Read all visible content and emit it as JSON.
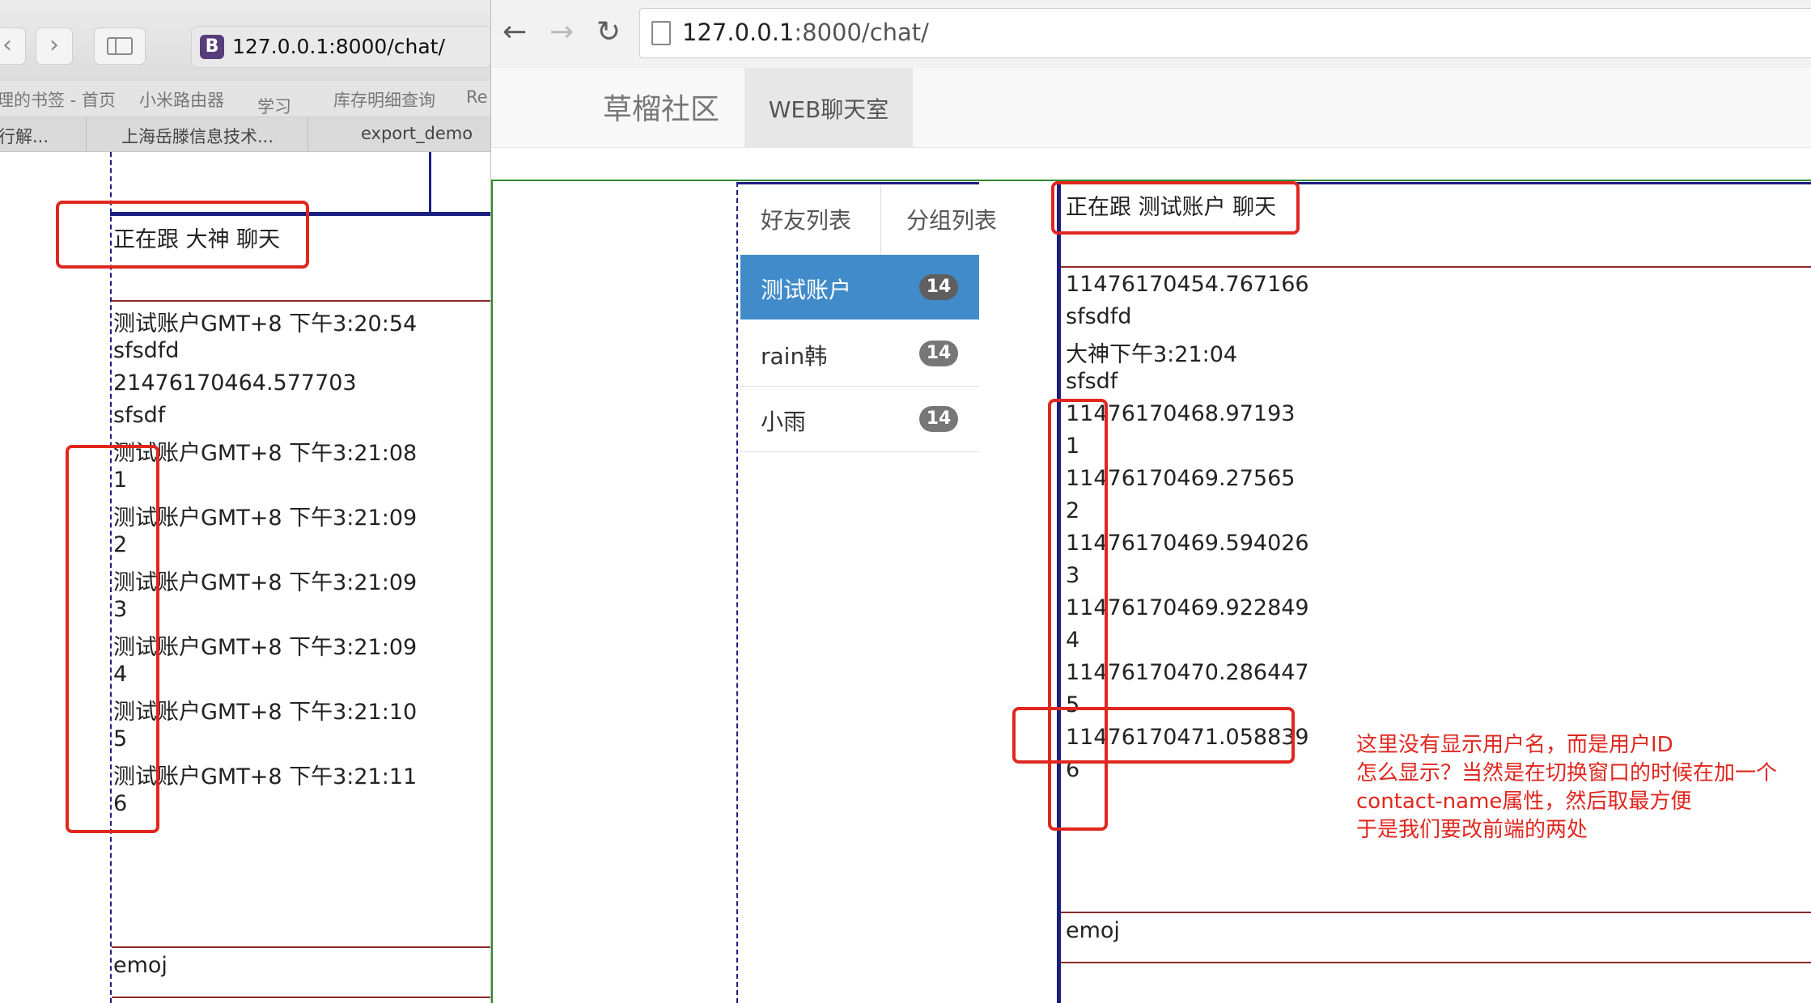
{
  "left_window": {
    "url": "127.0.0.1:8000/chat/",
    "bookmarks": [
      "理的书签 - 首页",
      "小米路由器",
      "学习",
      "库存明细查询",
      "Re"
    ],
    "tabs": [
      "行解...",
      "上海岳滕信息技术...",
      "export_demo"
    ],
    "chat_header": "正在跟 大神 聊天",
    "messages": [
      "测试账户GMT+8 下午3:20:54",
      "sfsdfd",
      "21476170464.577703",
      "sfsdf",
      "测试账户GMT+8 下午3:21:08",
      "1",
      "测试账户GMT+8 下午3:21:09",
      "2",
      "测试账户GMT+8 下午3:21:09",
      "3",
      "测试账户GMT+8 下午3:21:09",
      "4",
      "测试账户GMT+8 下午3:21:10",
      "5",
      "测试账户GMT+8 下午3:21:11",
      "6"
    ],
    "input_value": "emoj"
  },
  "right_window": {
    "url_host": "127.0.0.1",
    "url_rest": ":8000/chat/",
    "brand": "草榴社区",
    "nav_item": "WEB聊天室",
    "friend_tabs": [
      "好友列表",
      "分组列表"
    ],
    "friends": [
      {
        "name": "测试账户",
        "badge": "14",
        "active": true
      },
      {
        "name": "rain韩",
        "badge": "14",
        "active": false
      },
      {
        "name": "小雨",
        "badge": "14",
        "active": false
      }
    ],
    "chat_header": "正在跟 测试账户 聊天",
    "messages": [
      "11476170454.767166",
      "sfsdfd",
      "大神下午3:21:04",
      "sfsdf",
      "11476170468.97193",
      "1",
      "11476170469.27565",
      "2",
      "11476170469.594026",
      "3",
      "11476170469.922849",
      "4",
      "11476170470.286447",
      "5",
      "11476170471.058839",
      "6"
    ],
    "input_value": "emoj"
  },
  "annotation": [
    "这里没有显示用户名，而是用户ID",
    "怎么显示？当然是在切换窗口的时候在加一个",
    "contact-name属性，然后取最方便",
    "于是我们要改前端的两处"
  ],
  "colors": {
    "annotation_red": "#e0271f",
    "navy_border": "#1a1f80",
    "active_friend_bg": "#428bca",
    "bootstrap_purple": "#563d7c"
  }
}
